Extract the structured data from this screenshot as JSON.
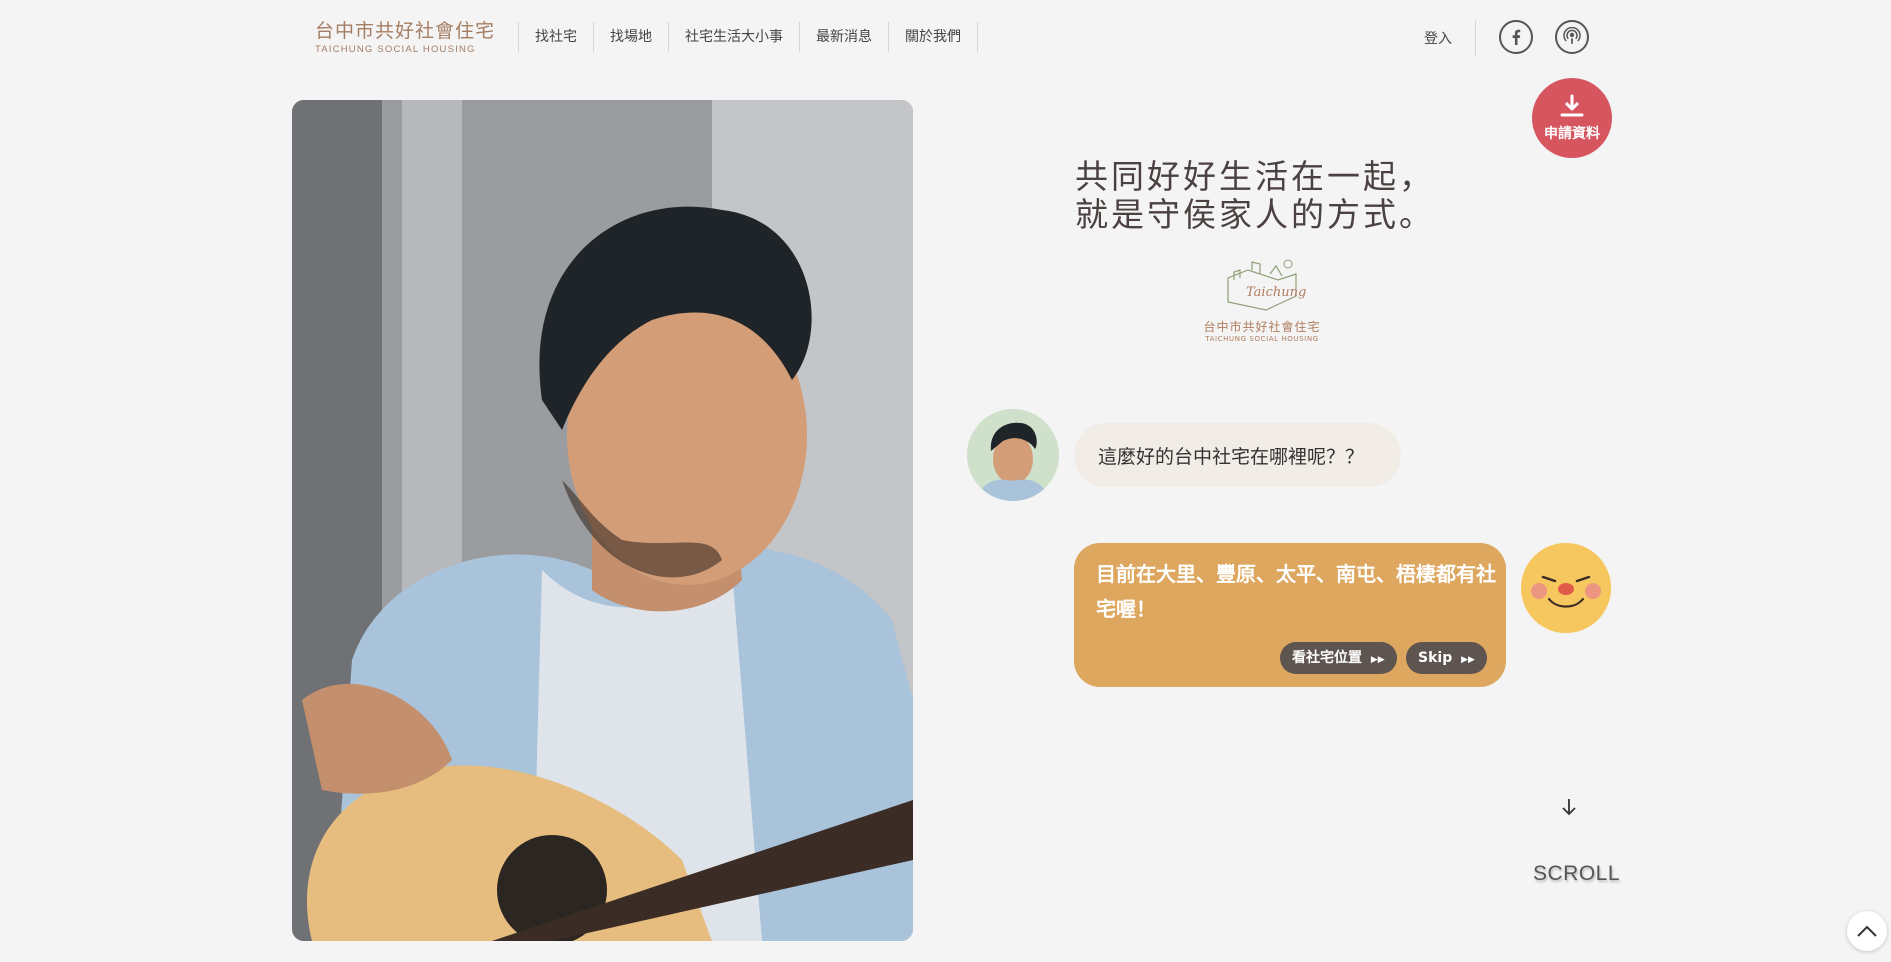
{
  "header": {
    "logo": {
      "cn": "台中市共好社會住宅",
      "en": "TAICHUNG SOCIAL HOUSING"
    },
    "nav": [
      "找社宅",
      "找場地",
      "社宅生活大小事",
      "最新消息",
      "關於我們"
    ],
    "login_label": "登入",
    "icons": {
      "facebook": "facebook-icon",
      "podcast": "podcast-icon"
    }
  },
  "hero": {
    "photo_alt": "man-playing-guitar",
    "headline": [
      "共同好好生活在一起，",
      "就是守侯家人的方式。"
    ],
    "mid_logo": {
      "script": "Taichung",
      "cn": "台中市共好社會住宅",
      "en": "TAICHUNG SOCIAL HOUSING"
    }
  },
  "chat": {
    "question": "這麼好的台中社宅在哪裡呢？？",
    "answer": "目前在大里、豐原、太平、南屯、梧棲都有社宅喔！",
    "buttons": {
      "location": "看社宅位置",
      "skip": "Skip"
    }
  },
  "apply_button": {
    "label": "申請資料"
  },
  "scroll_label": "SCROLL",
  "colors": {
    "accent_red": "#d6555f",
    "answer_bubble": "#dda760",
    "question_bubble": "#f2ece6",
    "brand_brown": "#a57d62"
  }
}
